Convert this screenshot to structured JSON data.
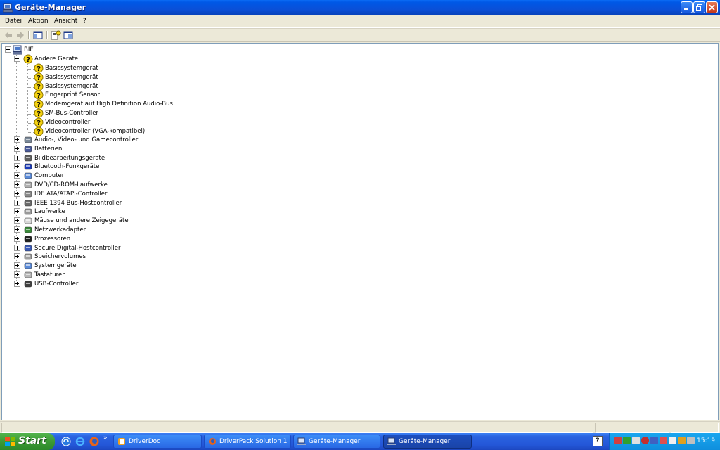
{
  "window": {
    "title": "Geräte-Manager"
  },
  "menu": [
    "Datei",
    "Aktion",
    "Ansicht",
    "?"
  ],
  "tree": {
    "root": "BIE",
    "other_devices": {
      "label": "Andere Geräte",
      "children": [
        "Basissystemgerät",
        "Basissystemgerät",
        "Basissystemgerät",
        "Fingerprint Sensor",
        "Modemgerät auf High Definition Audio-Bus",
        "SM-Bus-Controller",
        "Videocontroller",
        "Videocontroller (VGA-kompatibel)"
      ]
    },
    "categories": [
      "Audio-, Video- und Gamecontroller",
      "Batterien",
      "Bildbearbeitungsgeräte",
      "Bluetooth-Funkgeräte",
      "Computer",
      "DVD/CD-ROM-Laufwerke",
      "IDE ATA/ATAPI-Controller",
      "IEEE 1394 Bus-Hostcontroller",
      "Laufwerke",
      "Mäuse und andere Zeigegeräte",
      "Netzwerkadapter",
      "Prozessoren",
      "Secure Digital-Hostcontroller",
      "Speichervolumes",
      "Systemgeräte",
      "Tastaturen",
      "USB-Controller"
    ]
  },
  "taskbar": {
    "start_label": "Start",
    "tasks": [
      "DriverDoc",
      "DriverPack Solution 1...",
      "Geräte-Manager",
      "Geräte-Manager"
    ],
    "help_label": "?",
    "clock": "15:19"
  },
  "colors": {
    "titlebar": "#0058e6",
    "taskbar": "#2457d8",
    "start": "#3c9a35",
    "warning": "#f5d312"
  }
}
